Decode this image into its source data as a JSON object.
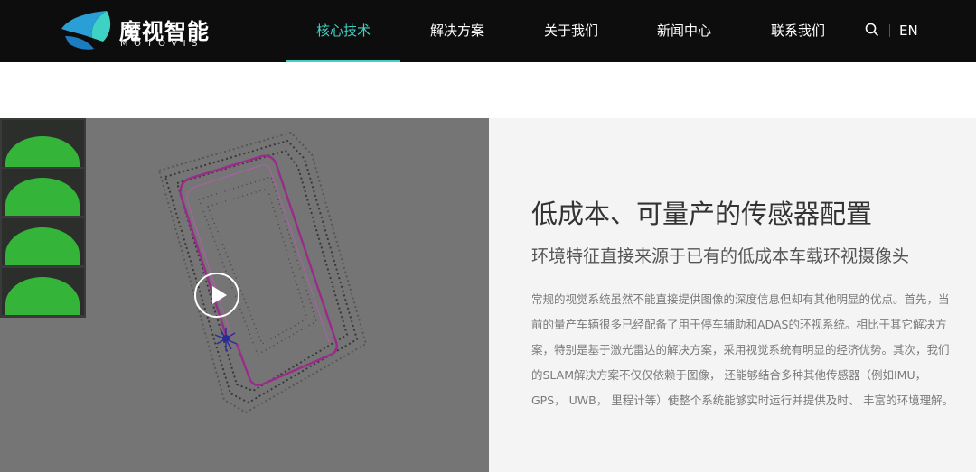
{
  "brand": {
    "name_cn": "魔视智能",
    "name_en": "MOTOVIS"
  },
  "nav": {
    "items": [
      {
        "label": "核心技术",
        "active": true
      },
      {
        "label": "解决方案",
        "active": false
      },
      {
        "label": "关于我们",
        "active": false
      },
      {
        "label": "新闻中心",
        "active": false
      },
      {
        "label": "联系我们",
        "active": false
      }
    ],
    "language": "EN"
  },
  "feature": {
    "title": "低成本、可量产的传感器配置",
    "subtitle": "环境特征直接来源于已有的低成本车载环视摄像头",
    "body_lines": [
      "常规的视觉系统虽然不能直接提供图像的深度信息但却有其他明显的优点。首先，当",
      "前的量产车辆很多已经配备了用于停车辅助和ADAS的环视系统。相比于其它解决方",
      "案，特别是基于激光雷达的解决方案，采用视觉系统有明显的经济优势。其次，我们",
      "的SLAM解决方案不仅仅依赖于图像， 还能够结合多种其他传感器（例如IMU，",
      "GPS， UWB， 里程计等）使整个系统能够实时运行并提供及时、 丰富的环境理解。"
    ]
  },
  "colors": {
    "header_bg": "#0d0d0d",
    "accent": "#3ed2c4",
    "video_bg": "#757575",
    "panel_bg": "#f4f4f4",
    "trajectory": "#9b2b8a"
  },
  "icons": {
    "search": "search-icon",
    "play": "play-icon",
    "logo": "motovis-logo-icon"
  }
}
